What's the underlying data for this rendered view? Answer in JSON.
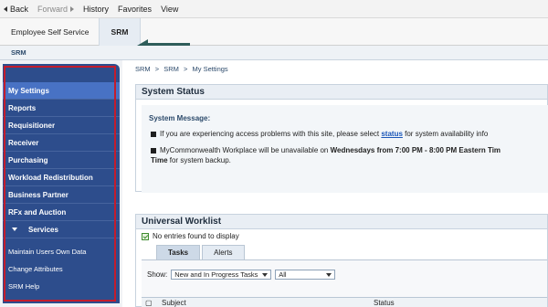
{
  "topnav": {
    "back": "Back",
    "forward": "Forward",
    "history": "History",
    "favorites": "Favorites",
    "view": "View"
  },
  "tabs": {
    "ess": "Employee Self Service",
    "srm": "SRM"
  },
  "subheader": "SRM",
  "leftnav": {
    "items": [
      "My Settings",
      "Reports",
      "Requisitioner",
      "Receiver",
      "Purchasing",
      "Workload Redistribution",
      "Business Partner",
      "RFx and Auction"
    ],
    "services_label": "Services",
    "service_items": [
      "Maintain Users Own Data",
      "Change Attributes",
      "SRM Help"
    ]
  },
  "breadcrumb": [
    "SRM",
    ">",
    "SRM",
    ">",
    "My Settings"
  ],
  "system_status": {
    "title": "System Status",
    "message_label": "System Message:",
    "msg1_pre": "If you are experiencing access problems with this site, please select ",
    "msg1_link": "status",
    "msg1_post": " for system availability info",
    "msg2_pre": "MyCommonwealth Workplace will be unavailable on ",
    "msg2_bold": "Wednesdays from 7:00 PM - 8:00 PM Eastern Tim",
    "msg2_bold2": "Time",
    "msg2_post": " for system backup."
  },
  "worklist": {
    "title": "Universal Worklist",
    "no_entries": "No entries found to display",
    "tabs": [
      "Tasks",
      "Alerts"
    ],
    "show_label": "Show:",
    "show_value": "New and In Progress Tasks",
    "filter_value": "All",
    "col_subject": "Subject",
    "col_status": "Status"
  },
  "colors": {
    "nav_bg": "#2d4d8c",
    "nav_active": "#4872c4",
    "highlight_red": "#c41c2c",
    "arrow_teal": "#2e5d5a"
  }
}
